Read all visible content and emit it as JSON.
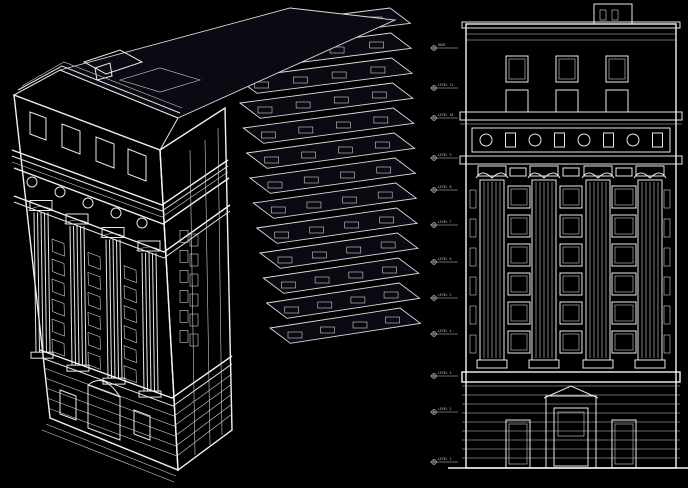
{
  "colors": {
    "background": "#000000",
    "line": "#e8e8e8",
    "plan_green": "#6fd36a",
    "plan_purple": "#8a5bd6",
    "plan_red": "#d23a3a",
    "plan_pink": "#d86bd0",
    "plan_cyan": "#57c7d6"
  },
  "elevation": {
    "levels": [
      {
        "label": "ROOF",
        "value": "ROOF"
      },
      {
        "label": "LEVEL 11",
        "value": ""
      },
      {
        "label": "LEVEL 10",
        "value": ""
      },
      {
        "label": "LEVEL 9",
        "value": ""
      },
      {
        "label": "LEVEL 8",
        "value": ""
      },
      {
        "label": "LEVEL 7",
        "value": ""
      },
      {
        "label": "LEVEL 6",
        "value": ""
      },
      {
        "label": "LEVEL 5",
        "value": ""
      },
      {
        "label": "LEVEL 4",
        "value": ""
      },
      {
        "label": "LEVEL 3",
        "value": ""
      },
      {
        "label": "LEVEL 2",
        "value": ""
      },
      {
        "label": "LEVEL 1",
        "value": ""
      }
    ]
  }
}
